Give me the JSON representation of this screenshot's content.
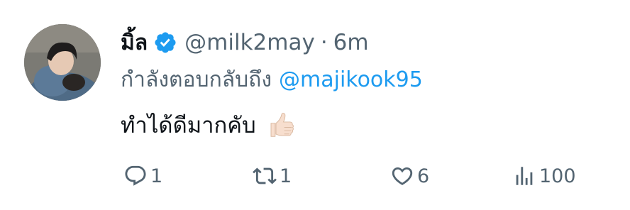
{
  "tweet": {
    "author_name": "มิ้ล",
    "verified": true,
    "handle": "@milk2may",
    "separator": "·",
    "time": "6m",
    "reply_prefix": "กำลังตอบกลับถึง",
    "reply_to": "@majikook95",
    "text": "ทำได้ดีมากคับ",
    "emoji": "thumbs-up-light-skin-tone"
  },
  "actions": {
    "replies": "1",
    "retweets": "1",
    "likes": "6",
    "views": "100"
  },
  "colors": {
    "text_primary": "#0f1419",
    "text_secondary": "#536471",
    "accent": "#1d9bf0"
  },
  "icons": {
    "reply": "reply-icon",
    "retweet": "retweet-icon",
    "like": "heart-icon",
    "views": "views-icon",
    "verified": "verified-badge-icon"
  }
}
